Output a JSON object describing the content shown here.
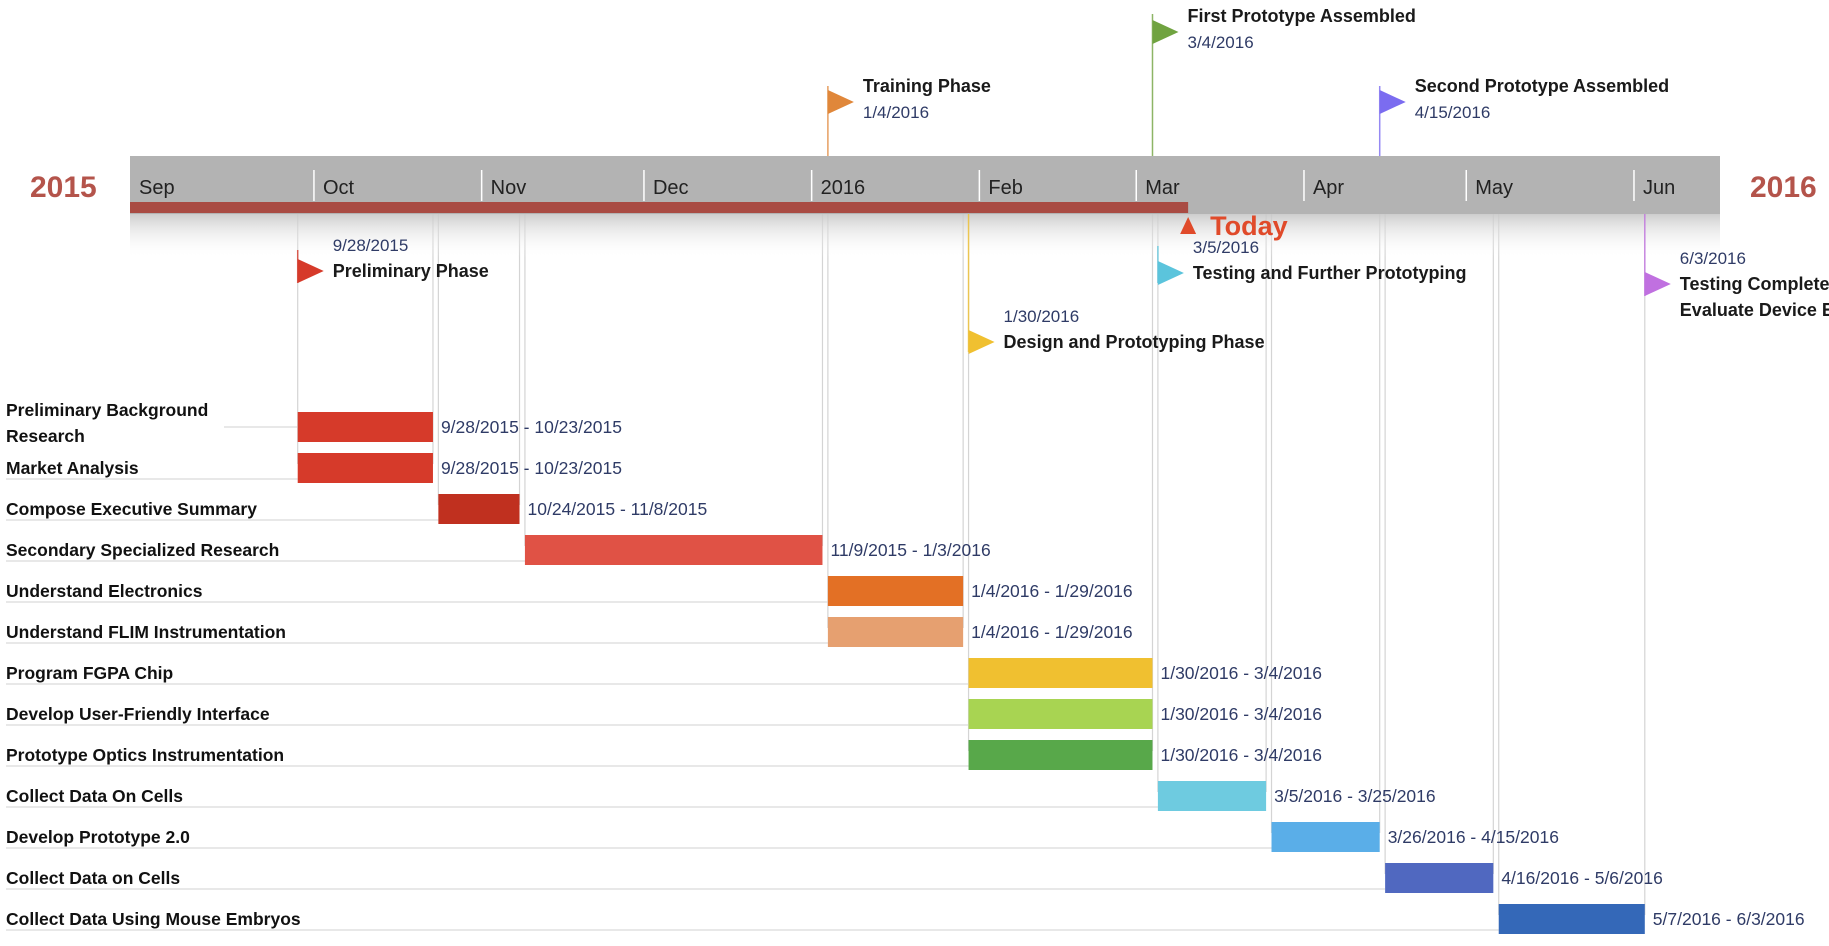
{
  "chart_data": {
    "type": "gantt",
    "start_year_label": "2015",
    "end_year_label": "2016",
    "month_labels": [
      "Sep",
      "Oct",
      "Nov",
      "Dec",
      "2016",
      "Feb",
      "Mar",
      "Apr",
      "May",
      "Jun"
    ],
    "today": {
      "label": "Today",
      "date": "2016-03-08"
    },
    "milestones": [
      {
        "title": "First Prototype Assembled",
        "date_label": "3/4/2016",
        "date": "2016-03-04",
        "side": "above",
        "color": "#70a340"
      },
      {
        "title": "Training Phase",
        "date_label": "1/4/2016",
        "date": "2016-01-04",
        "side": "above",
        "color": "#e0873a"
      },
      {
        "title": "Second Prototype Assembled",
        "date_label": "4/15/2016",
        "date": "2016-04-15",
        "side": "above",
        "color": "#7b6cf0"
      },
      {
        "title": "Preliminary Phase",
        "date_label": "9/28/2015",
        "date": "2015-09-28",
        "side": "below",
        "color": "#d63a2a"
      },
      {
        "title": "Testing and Further Prototyping",
        "date_label": "3/5/2016",
        "date": "2016-03-05",
        "side": "below",
        "color": "#5bc4dc"
      },
      {
        "title": "Design and Prototyping Phase",
        "date_label": "1/30/2016",
        "date": "2016-01-30",
        "side": "below",
        "color": "#f0c030"
      },
      {
        "title": "Testing Complete & Evaluate Device Efficacy",
        "date_label": "6/3/2016",
        "date": "2016-06-03",
        "side": "below",
        "color": "#c070e0"
      }
    ],
    "tasks": [
      {
        "name": "Preliminary Background Research",
        "start": "2015-09-28",
        "end": "2015-10-23",
        "range_label": "9/28/2015 - 10/23/2015",
        "color": "#d63a2a"
      },
      {
        "name": "Market Analysis",
        "start": "2015-09-28",
        "end": "2015-10-23",
        "range_label": "9/28/2015 - 10/23/2015",
        "color": "#d63a2a"
      },
      {
        "name": "Compose Executive Summary",
        "start": "2015-10-24",
        "end": "2015-11-08",
        "range_label": "10/24/2015 - 11/8/2015",
        "color": "#c0301f"
      },
      {
        "name": "Secondary Specialized Research",
        "start": "2015-11-09",
        "end": "2016-01-03",
        "range_label": "11/9/2015 - 1/3/2016",
        "color": "#e05245"
      },
      {
        "name": "Understand Electronics",
        "start": "2016-01-04",
        "end": "2016-01-29",
        "range_label": "1/4/2016 - 1/29/2016",
        "color": "#e37025"
      },
      {
        "name": "Understand FLIM Instrumentation",
        "start": "2016-01-04",
        "end": "2016-01-29",
        "range_label": "1/4/2016 - 1/29/2016",
        "color": "#e6a070"
      },
      {
        "name": "Program FGPA Chip",
        "start": "2016-01-30",
        "end": "2016-03-04",
        "range_label": "1/30/2016 - 3/4/2016",
        "color": "#f0c030"
      },
      {
        "name": "Develop User-Friendly Interface",
        "start": "2016-01-30",
        "end": "2016-03-04",
        "range_label": "1/30/2016 - 3/4/2016",
        "color": "#a8d452"
      },
      {
        "name": "Prototype Optics Instrumentation",
        "start": "2016-01-30",
        "end": "2016-03-04",
        "range_label": "1/30/2016 - 3/4/2016",
        "color": "#58a84a"
      },
      {
        "name": "Collect Data On Cells",
        "start": "2016-03-05",
        "end": "2016-03-25",
        "range_label": "3/5/2016 - 3/25/2016",
        "color": "#6ecbe0"
      },
      {
        "name": "Develop Prototype 2.0",
        "start": "2016-03-26",
        "end": "2016-04-15",
        "range_label": "3/26/2016 - 4/15/2016",
        "color": "#5aaee8"
      },
      {
        "name": "Collect Data on Cells",
        "start": "2016-04-16",
        "end": "2016-05-06",
        "range_label": "4/16/2016 - 5/6/2016",
        "color": "#5068c0"
      },
      {
        "name": "Collect Data Using Mouse Embryos",
        "start": "2016-05-07",
        "end": "2016-06-03",
        "range_label": "5/7/2016 - 6/3/2016",
        "color": "#3468b8"
      }
    ]
  },
  "colors": {
    "timeline_band": "#b3b3b3",
    "progress_bar": "#a94b43",
    "year_text": "#b4544b",
    "today_marker": "#e04a2a",
    "leader_line": "#d4d4d4",
    "row_line": "#d9d9d9"
  }
}
